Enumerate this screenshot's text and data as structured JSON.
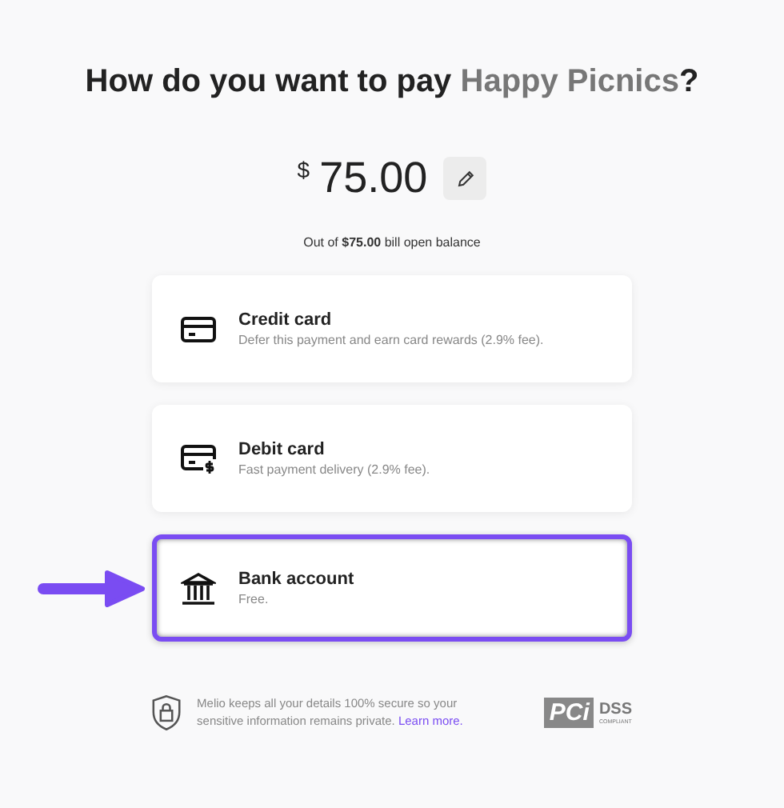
{
  "title": {
    "prefix": "How do you want to pay ",
    "payee": "Happy Picnics",
    "suffix": "?"
  },
  "amount": {
    "currency": "$",
    "value": "75.00"
  },
  "balance_note": "Out of **$75.00** bill open balance",
  "methods": [
    {
      "kind": "credit",
      "name": "Credit card",
      "description": "Defer this payment and earn card rewards (2.9% fee).",
      "selected": false
    },
    {
      "kind": "debit",
      "name": "Debit card",
      "description": "Fast payment delivery (2.9% fee).",
      "selected": false
    },
    {
      "kind": "bank",
      "name": "Bank account",
      "description": "Free.",
      "selected": true
    }
  ],
  "footer": {
    "text": "Melio keeps all your details 100% secure so your sensitive information remains private.",
    "link": "Learn more.",
    "badge": {
      "mark": "PCi",
      "label": "DSS",
      "sub": "COMPLIANT"
    }
  }
}
